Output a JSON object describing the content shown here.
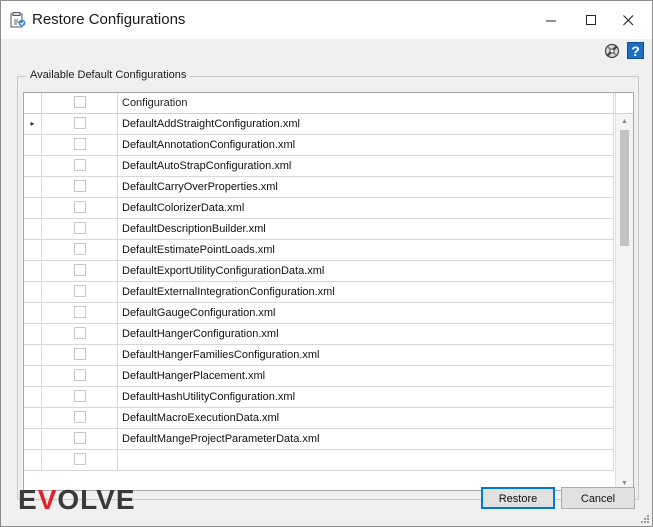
{
  "window": {
    "title": "Restore Configurations",
    "icon": "restore-config-icon",
    "controls": {
      "minimize": "minimize-icon",
      "maximize": "maximize-icon",
      "close": "close-icon"
    }
  },
  "toolbar": {
    "settings_icon": "settings-wrench-icon",
    "help_label": "?"
  },
  "group": {
    "title": "Available Default Configurations"
  },
  "grid": {
    "columns": [
      {
        "key": "indicator",
        "label": ""
      },
      {
        "key": "selected",
        "label": ""
      },
      {
        "key": "configuration",
        "label": "Configuration"
      }
    ],
    "current_row_marker": "▸",
    "rows": [
      {
        "configuration": "DefaultAddStraightConfiguration.xml",
        "selected": false,
        "current": true
      },
      {
        "configuration": "DefaultAnnotationConfiguration.xml",
        "selected": false,
        "current": false
      },
      {
        "configuration": "DefaultAutoStrapConfiguration.xml",
        "selected": false,
        "current": false
      },
      {
        "configuration": "DefaultCarryOverProperties.xml",
        "selected": false,
        "current": false
      },
      {
        "configuration": "DefaultColorizerData.xml",
        "selected": false,
        "current": false
      },
      {
        "configuration": "DefaultDescriptionBuilder.xml",
        "selected": false,
        "current": false
      },
      {
        "configuration": "DefaultEstimatePointLoads.xml",
        "selected": false,
        "current": false
      },
      {
        "configuration": "DefaultExportUtilityConfigurationData.xml",
        "selected": false,
        "current": false
      },
      {
        "configuration": "DefaultExternalIntegrationConfiguration.xml",
        "selected": false,
        "current": false
      },
      {
        "configuration": "DefaultGaugeConfiguration.xml",
        "selected": false,
        "current": false
      },
      {
        "configuration": "DefaultHangerConfiguration.xml",
        "selected": false,
        "current": false
      },
      {
        "configuration": "DefaultHangerFamiliesConfiguration.xml",
        "selected": false,
        "current": false
      },
      {
        "configuration": "DefaultHangerPlacement.xml",
        "selected": false,
        "current": false
      },
      {
        "configuration": "DefaultHashUtilityConfiguration.xml",
        "selected": false,
        "current": false
      },
      {
        "configuration": "DefaultMacroExecutionData.xml",
        "selected": false,
        "current": false
      },
      {
        "configuration": "DefaultMangeProjectParameterData.xml",
        "selected": false,
        "current": false
      },
      {
        "configuration": "",
        "selected": false,
        "current": false
      }
    ]
  },
  "footer": {
    "logo_text_start": "E",
    "logo_text_accent": "V",
    "logo_text_end": "OLVE",
    "restore_label": "Restore",
    "cancel_label": "Cancel"
  }
}
